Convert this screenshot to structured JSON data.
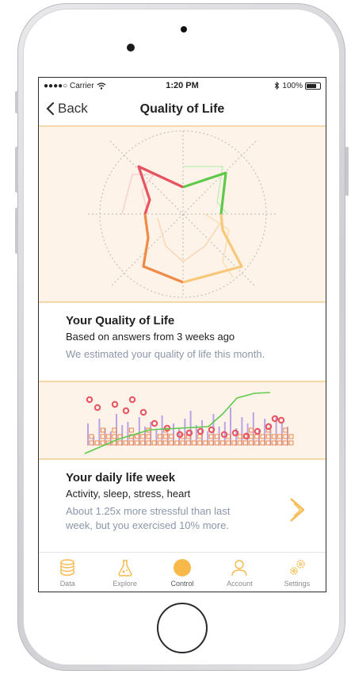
{
  "status_bar": {
    "carrier": "●●●●○ Carrier",
    "time": "1:20 PM",
    "battery": "100%"
  },
  "nav": {
    "back_label": "Back",
    "title": "Quality of Life"
  },
  "quality_card": {
    "title": "Your Quality of Life",
    "subtitle": "Based on answers from 3 weeks ago",
    "description": "We estimated your quality of life this month."
  },
  "week_card": {
    "title": "Your daily life week",
    "subtitle": "Activity, sleep, stress, heart",
    "description": "About 1.25x more stressful than last week, but you exercised 10% more."
  },
  "tabs": [
    {
      "label": "Data",
      "icon": "database-icon",
      "active": false
    },
    {
      "label": "Explore",
      "icon": "flask-icon",
      "active": false
    },
    {
      "label": "Control",
      "icon": "circle-icon",
      "active": true
    },
    {
      "label": "Account",
      "icon": "user-icon",
      "active": false
    },
    {
      "label": "Settings",
      "icon": "gears-icon",
      "active": false
    }
  ],
  "colors": {
    "accent": "#f8b84a",
    "panel_bg": "#fdf3e9",
    "divider": "#f4d8a8",
    "green": "#5fc94a",
    "red": "#e85360",
    "orange": "#f08a45",
    "light_orange": "#f8c87a",
    "muted_text": "#8b97a8",
    "purple": "#b9a2e6"
  }
}
